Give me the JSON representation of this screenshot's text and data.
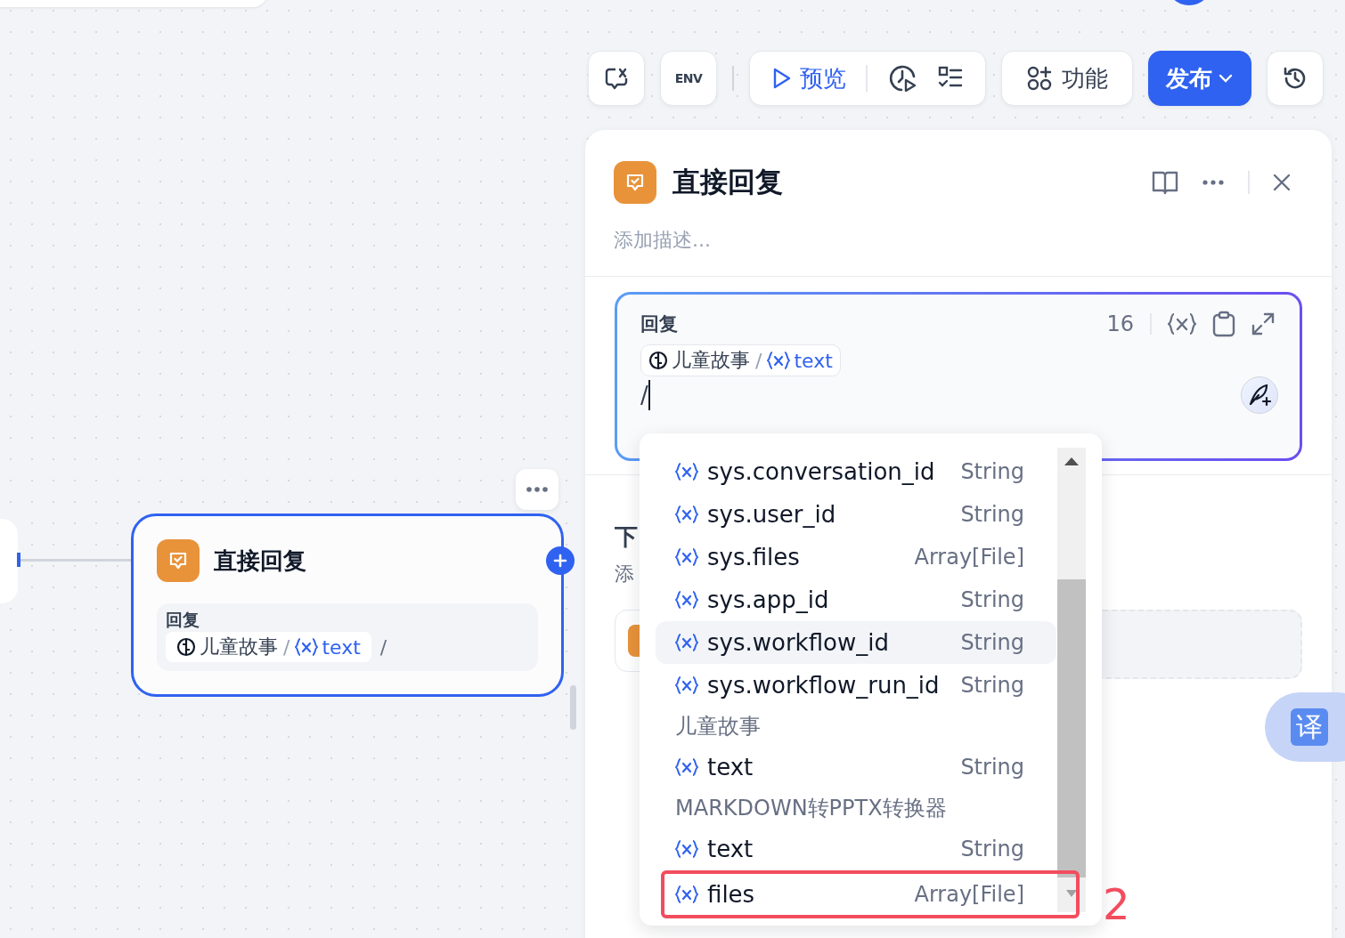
{
  "toolbar": {
    "env_label": "ENV",
    "preview": "预览",
    "features": "功能",
    "publish": "发布"
  },
  "canvas": {
    "node": {
      "title": "直接回复",
      "field_label": "回复",
      "source": "儿童故事",
      "separator": "/",
      "variable": "text",
      "trailing": "/"
    }
  },
  "panel": {
    "title": "直接回复",
    "description_placeholder": "添加描述...",
    "reply": {
      "label": "回复",
      "count": "16",
      "source": "儿童故事",
      "separator": "/",
      "variable": "text",
      "typed": "/"
    },
    "next_step": {
      "title": "下",
      "hint": "添"
    }
  },
  "variable_menu": {
    "items": [
      {
        "kind": "var",
        "name": "sys.conversation_id",
        "type": "String",
        "selected": false,
        "annotated": false
      },
      {
        "kind": "var",
        "name": "sys.user_id",
        "type": "String",
        "selected": false,
        "annotated": false
      },
      {
        "kind": "var",
        "name": "sys.files",
        "type": "Array[File]",
        "selected": false,
        "annotated": false
      },
      {
        "kind": "var",
        "name": "sys.app_id",
        "type": "String",
        "selected": false,
        "annotated": false
      },
      {
        "kind": "var",
        "name": "sys.workflow_id",
        "type": "String",
        "selected": true,
        "annotated": false
      },
      {
        "kind": "var",
        "name": "sys.workflow_run_id",
        "type": "String",
        "selected": false,
        "annotated": false
      },
      {
        "kind": "group",
        "label": "儿童故事"
      },
      {
        "kind": "var",
        "name": "text",
        "type": "String",
        "selected": false,
        "annotated": false
      },
      {
        "kind": "group",
        "label": "MARKDOWN转PPTX转换器"
      },
      {
        "kind": "var",
        "name": "text",
        "type": "String",
        "selected": false,
        "annotated": false
      },
      {
        "kind": "var",
        "name": "files",
        "type": "Array[File]",
        "selected": false,
        "annotated": true
      }
    ]
  },
  "annotation": {
    "label": "2"
  },
  "translate_button": {
    "label": "译"
  }
}
